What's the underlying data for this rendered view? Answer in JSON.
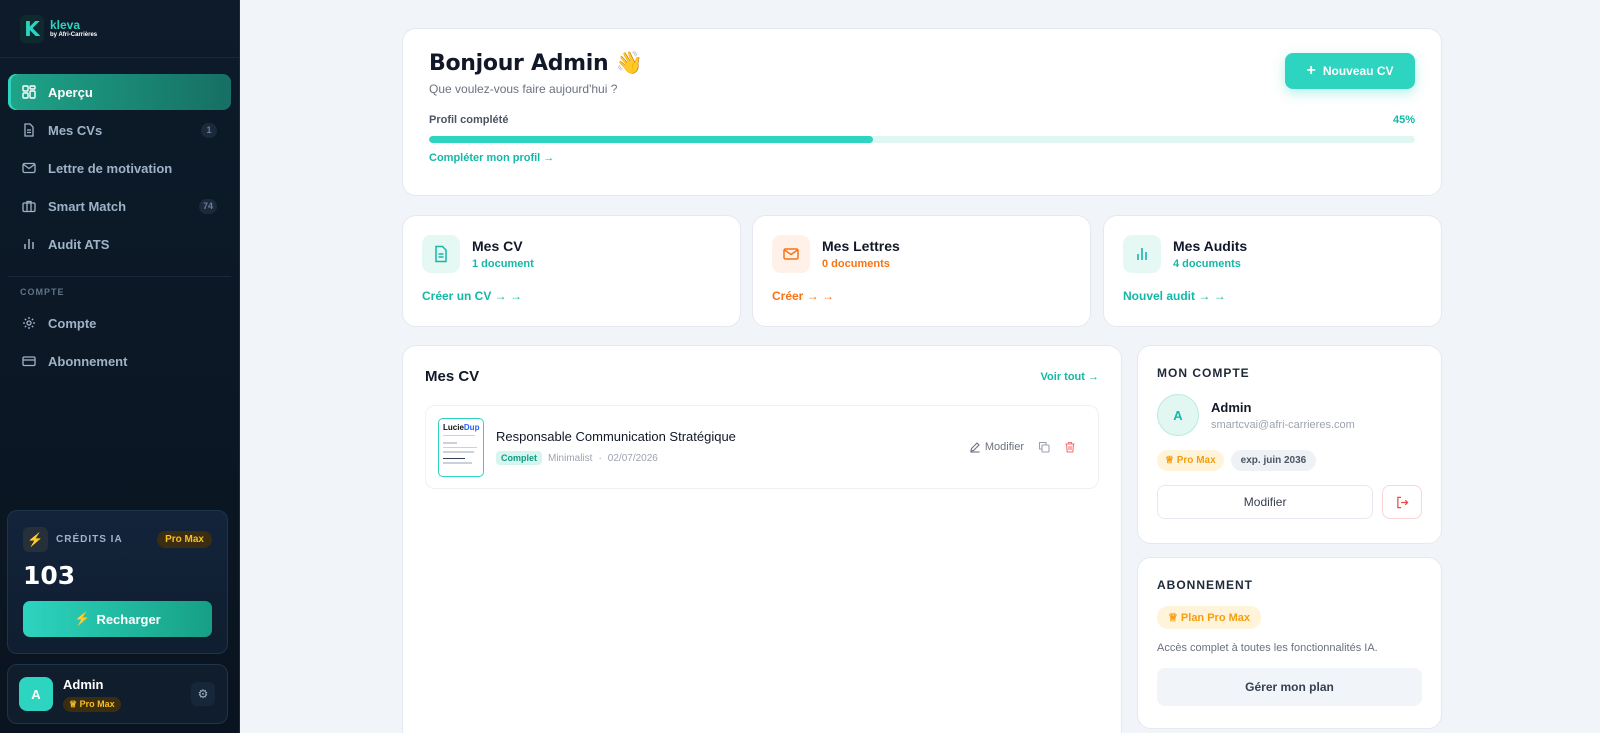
{
  "brand": {
    "logo_letter": "K",
    "name": "kleva",
    "subtitle": "by Afri-Carrières"
  },
  "sidebar": {
    "items": [
      {
        "label": "Aperçu",
        "icon": "grid-icon",
        "active": true,
        "badge": ""
      },
      {
        "label": "Mes CVs",
        "icon": "file-icon",
        "active": false,
        "badge": "1"
      },
      {
        "label": "Lettre de motivation",
        "icon": "mail-icon",
        "active": false,
        "badge": ""
      },
      {
        "label": "Smart Match",
        "icon": "briefcase-icon",
        "active": false,
        "badge": "74"
      },
      {
        "label": "Audit ATS",
        "icon": "bar-chart-icon",
        "active": false,
        "badge": ""
      }
    ],
    "section_label": "COMPTE",
    "account_items": [
      {
        "label": "Compte",
        "icon": "gear-icon"
      },
      {
        "label": "Abonnement",
        "icon": "credit-card-icon"
      }
    ]
  },
  "credits": {
    "label": "CRÉDITS IA",
    "plan": "Pro Max",
    "value": "103",
    "recharge_label": "Recharger"
  },
  "user": {
    "initial": "A",
    "name": "Admin",
    "plan": "Pro Max"
  },
  "welcome": {
    "title": "Bonjour Admin 👋",
    "subtitle": "Que voulez-vous faire aujourd'hui ?",
    "new_cv_label": "Nouveau CV",
    "progress_label": "Profil complété",
    "progress_percent": 45,
    "progress_text": "45%",
    "complete_link": "Compléter mon profil"
  },
  "stats": [
    {
      "title": "Mes CV",
      "count": "1 document",
      "link": "Créer un CV →",
      "color": "#14b8a6",
      "bg": "#e6f8f4",
      "icon": "file-icon"
    },
    {
      "title": "Mes Lettres",
      "count": "0 documents",
      "link": "Créer →",
      "color": "#f97316",
      "bg": "#fff1e8",
      "icon": "mail-icon"
    },
    {
      "title": "Mes Audits",
      "count": "4 documents",
      "link": "Nouvel audit →",
      "color": "#14b8a6",
      "bg": "#e6f8f4",
      "icon": "bar-chart-icon"
    }
  ],
  "cv_list": {
    "title": "Mes CV",
    "see_all": "Voir tout",
    "items": [
      {
        "thumb_first": "Lucie",
        "thumb_last": "Dup",
        "title": "Responsable Communication Stratégique",
        "status": "Complet",
        "template": "Minimalist",
        "date": "02/07/2026",
        "edit_label": "Modifier"
      }
    ]
  },
  "account": {
    "title": "MON COMPTE",
    "initial": "A",
    "name": "Admin",
    "email": "smartcvai@afri-carrieres.com",
    "plan_tag": "Pro Max",
    "expiry_tag": "exp. juin 2036",
    "edit_label": "Modifier"
  },
  "subscription": {
    "title": "ABONNEMENT",
    "plan_tag": "Plan Pro Max",
    "description": "Accès complet à toutes les fonctionnalités IA.",
    "manage_label": "Gérer mon plan"
  },
  "colors": {
    "accent": "#2dd4bf",
    "sidebar_bg": "#0d1b2a",
    "gold": "#fbbf24",
    "orange": "#f97316"
  }
}
